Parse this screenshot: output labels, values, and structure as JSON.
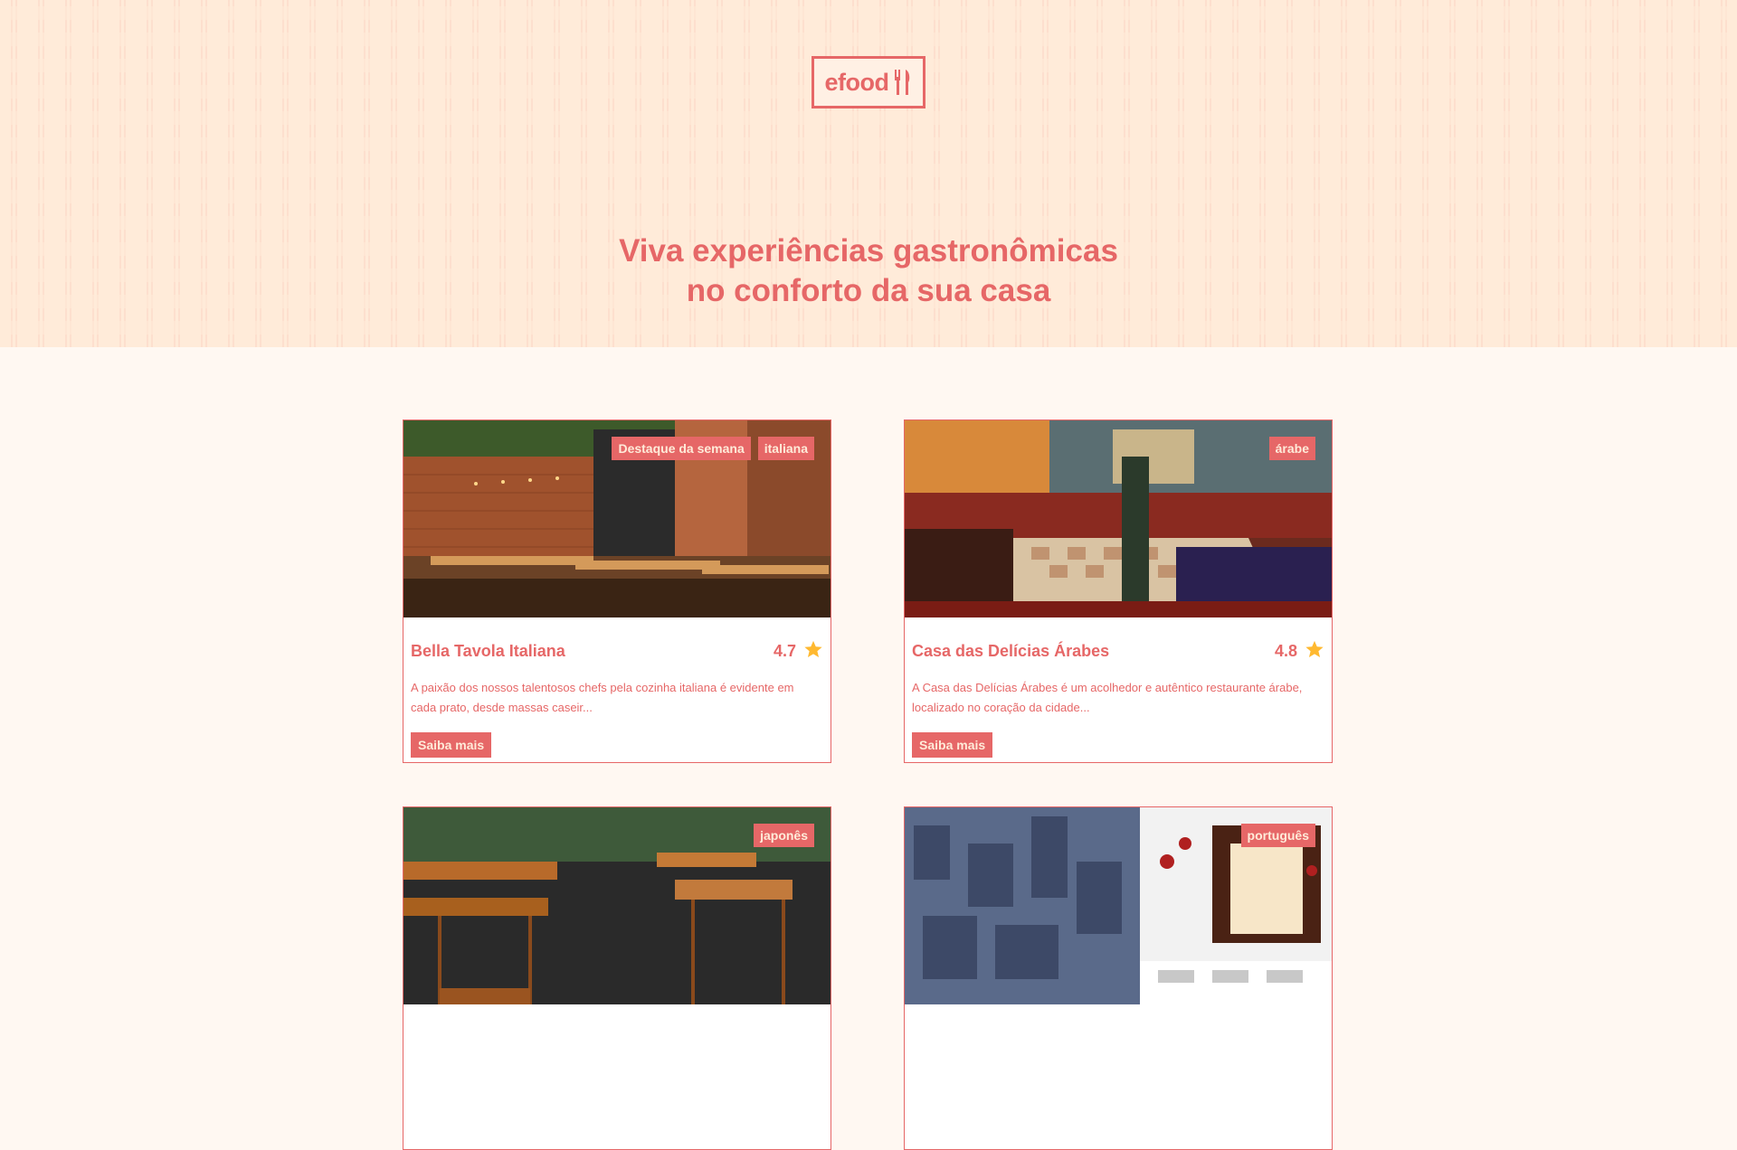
{
  "header": {
    "logo_text": "efood",
    "hero_line1": "Viva experiências gastronômicas",
    "hero_line2": "no conforto da sua casa"
  },
  "restaurants": [
    {
      "name": "Bella Tavola Italiana",
      "rating": "4.7",
      "tags": [
        "Destaque da semana",
        "italiana"
      ],
      "description": "A paixão dos nossos talentosos chefs pela cozinha italiana é evidente em cada prato, desde massas caseir...",
      "button": "Saiba mais"
    },
    {
      "name": "Casa das Delícias Árabes",
      "rating": "4.8",
      "tags": [
        "árabe"
      ],
      "description": "A Casa das Delícias Árabes é um acolhedor e autêntico restaurante árabe, localizado no coração da cidade...",
      "button": "Saiba mais"
    },
    {
      "tags": [
        "japonês"
      ]
    },
    {
      "tags": [
        "português"
      ]
    }
  ],
  "colors": {
    "primary": "#E66767",
    "hero_bg": "#FFEBD9",
    "page_bg": "#FFF8F2",
    "star": "#FFB930"
  },
  "icons": {
    "logo": "fork-knife-icon",
    "rating": "star-icon"
  }
}
